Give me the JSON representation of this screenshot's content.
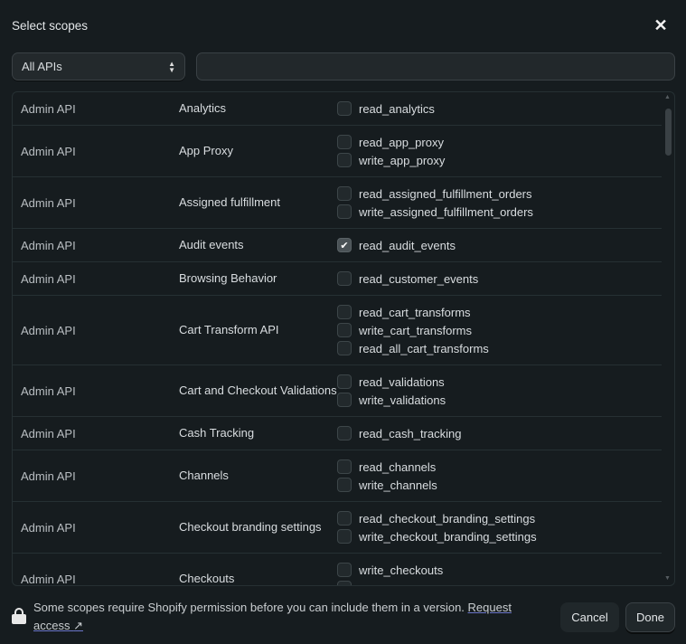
{
  "header": {
    "title": "Select scopes",
    "close_label": "✕"
  },
  "filter": {
    "selected": "All APIs",
    "search_value": "",
    "search_placeholder": ""
  },
  "rows": [
    {
      "api": "Admin API",
      "name": "Analytics",
      "scopes": [
        {
          "label": "read_analytics",
          "checked": false
        }
      ]
    },
    {
      "api": "Admin API",
      "name": "App Proxy",
      "scopes": [
        {
          "label": "read_app_proxy",
          "checked": false
        },
        {
          "label": "write_app_proxy",
          "checked": false
        }
      ]
    },
    {
      "api": "Admin API",
      "name": "Assigned fulfillment",
      "scopes": [
        {
          "label": "read_assigned_fulfillment_orders",
          "checked": false
        },
        {
          "label": "write_assigned_fulfillment_orders",
          "checked": false
        }
      ]
    },
    {
      "api": "Admin API",
      "name": "Audit events",
      "scopes": [
        {
          "label": "read_audit_events",
          "checked": true
        }
      ]
    },
    {
      "api": "Admin API",
      "name": "Browsing Behavior",
      "scopes": [
        {
          "label": "read_customer_events",
          "checked": false
        }
      ]
    },
    {
      "api": "Admin API",
      "name": "Cart Transform API",
      "scopes": [
        {
          "label": "read_cart_transforms",
          "checked": false
        },
        {
          "label": "write_cart_transforms",
          "checked": false
        },
        {
          "label": "read_all_cart_transforms",
          "checked": false
        }
      ]
    },
    {
      "api": "Admin API",
      "name": "Cart and Checkout Validations",
      "scopes": [
        {
          "label": "read_validations",
          "checked": false
        },
        {
          "label": "write_validations",
          "checked": false
        }
      ]
    },
    {
      "api": "Admin API",
      "name": "Cash Tracking",
      "scopes": [
        {
          "label": "read_cash_tracking",
          "checked": false
        }
      ]
    },
    {
      "api": "Admin API",
      "name": "Channels",
      "scopes": [
        {
          "label": "read_channels",
          "checked": false
        },
        {
          "label": "write_channels",
          "checked": false
        }
      ]
    },
    {
      "api": "Admin API",
      "name": "Checkout branding settings",
      "scopes": [
        {
          "label": "read_checkout_branding_settings",
          "checked": false
        },
        {
          "label": "write_checkout_branding_settings",
          "checked": false
        }
      ]
    },
    {
      "api": "Admin API",
      "name": "Checkouts",
      "scopes": [
        {
          "label": "write_checkouts",
          "checked": false
        },
        {
          "label": "",
          "checked": false
        }
      ]
    }
  ],
  "footer": {
    "message": "Some scopes require Shopify permission before you can include them in a version. ",
    "link_label": "Request access",
    "cancel_label": "Cancel",
    "done_label": "Done"
  }
}
